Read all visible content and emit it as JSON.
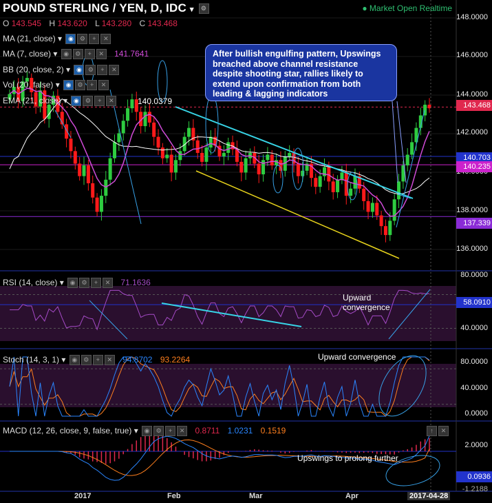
{
  "header": {
    "title": "POUND STERLING / YEN, D, IDC",
    "market_status": "Market Open",
    "realtime": "Realtime"
  },
  "ohlc": {
    "o_label": "O",
    "o": "143.545",
    "h_label": "H",
    "h": "143.620",
    "l_label": "L",
    "l": "143.280",
    "c_label": "C",
    "c": "143.468"
  },
  "indicators": {
    "ma21": "MA (21, close)",
    "ma7": "MA (7, close)",
    "ma7_value": "141.7641",
    "bb": "BB (20, close, 2)",
    "vol": "Vol (20, false)",
    "ema": "EMA (21, close)",
    "ema_value": "140.0379"
  },
  "price_ticks": [
    "148.0000",
    "146.0000",
    "144.0000",
    "142.0000",
    "140.0000",
    "138.0000",
    "136.0000"
  ],
  "price_tags": [
    {
      "text": "143.468",
      "color": "#e0284e"
    },
    {
      "text": "140.703",
      "color": "#2233cc"
    },
    {
      "text": "140.235",
      "color": "#cc22cc"
    },
    {
      "text": "137.339",
      "color": "#8a2bd6"
    }
  ],
  "note": "After bullish engulfing pattern, Upswings breached above channel resistance despite shooting star, rallies likely to extend upon confirmation from both leading & lagging indicators",
  "rsi": {
    "label": "RSI (14, close)",
    "value": "71.1636",
    "ticks": [
      "80.0000",
      "40.0000"
    ],
    "tag": "58.0910",
    "annotation": "Upward convergence"
  },
  "stoch": {
    "label": "Stoch (14, 3, 1)",
    "k": "94.8702",
    "d": "93.2264",
    "ticks": [
      "80.0000",
      "40.0000",
      "0.0000"
    ],
    "annotation": "Upward convergence"
  },
  "macd": {
    "label": "MACD (12, 26, close, 9, false, true)",
    "hist": "0.8711",
    "macd": "1.0231",
    "signal": "0.1519",
    "ticks": [
      "2.0000"
    ],
    "tag": "0.0936",
    "cut_tick": "-1.2188",
    "annotation": "Upswings to prolong further"
  },
  "x_labels": [
    "2017",
    "Feb",
    "Mar",
    "Apr",
    "2017-04-28"
  ],
  "colors": {
    "up": "#2ecc40",
    "down": "#ff1a1a",
    "bg": "#000000",
    "channel_top": "#37d4e6",
    "channel_bot": "#e6d21b",
    "rsi_line": "#a64bc8",
    "stoch_k": "#2a86ff",
    "stoch_d": "#ff7f1e",
    "macd": "#2a86ff",
    "signal": "#ff7f1e"
  },
  "chart_data": {
    "type": "candlestick",
    "instrument": "POUND STERLING / YEN, D, IDC",
    "ylim": [
      134.8,
      149.0
    ],
    "last_close": 143.468,
    "closes": [
      144.2,
      144.6,
      143.8,
      144.9,
      145.1,
      144.3,
      143.5,
      144.4,
      142.8,
      143.6,
      144.1,
      143.2,
      142.5,
      141.7,
      141.0,
      140.3,
      139.6,
      140.2,
      139.2,
      138.4,
      137.6,
      138.5,
      139.4,
      140.6,
      141.5,
      142.0,
      142.7,
      143.4,
      143.9,
      143.2,
      142.4,
      143.2,
      142.6,
      141.8,
      141.2,
      140.6,
      140.8,
      139.8,
      140.5,
      141.0,
      141.8,
      142.3,
      141.6,
      140.9,
      140.4,
      141.2,
      141.8,
      141.3,
      140.7,
      140.9,
      141.5,
      141.1,
      140.4,
      139.8,
      140.6,
      140.9,
      140.3,
      139.7,
      140.5,
      140.8,
      140.2,
      140.5,
      139.9,
      140.7,
      140.9,
      140.3,
      139.6,
      139.9,
      140.3,
      139.5,
      139.0,
      139.6,
      140.1,
      139.3,
      138.7,
      139.4,
      139.8,
      138.5,
      138.9,
      139.6,
      138.9,
      138.2,
      137.6,
      138.1,
      137.4,
      136.8,
      136.3,
      137.1,
      138.3,
      139.3,
      140.2,
      140.8,
      141.5,
      142.3,
      143.0,
      143.6,
      143.4
    ],
    "rsi": {
      "value": 71.1636,
      "levels": [
        70,
        30
      ]
    },
    "stoch": {
      "k": 94.8702,
      "d": 93.2264
    },
    "macd": {
      "hist": 0.8711,
      "macd": 1.0231,
      "signal": 0.1519
    }
  }
}
